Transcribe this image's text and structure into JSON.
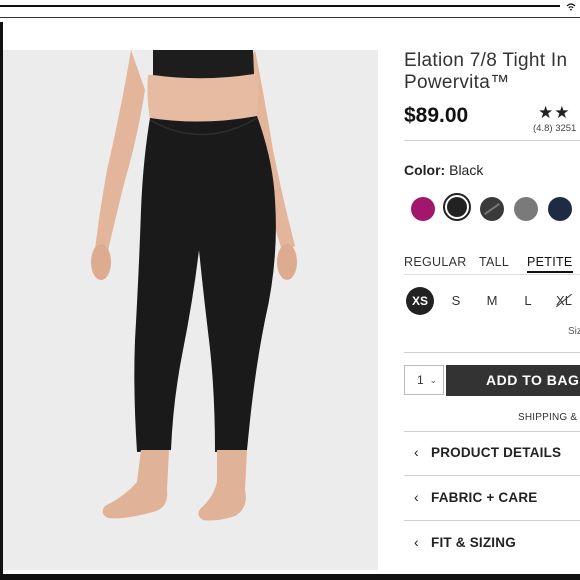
{
  "product": {
    "title": "Elation 7/8 Tight In\nPowervita™",
    "price": "$89.00",
    "stars": "★★",
    "rating": "(4.8)",
    "review_count": "3251"
  },
  "color": {
    "label": "Color:",
    "selected": "Black",
    "swatches": [
      {
        "name": "berry",
        "hex": "#a0176b"
      },
      {
        "name": "black",
        "hex": "#222222",
        "selected": true
      },
      {
        "name": "black-heather",
        "hex": "#3a3a3a"
      },
      {
        "name": "grey-heather",
        "hex": "#7a7a7a"
      },
      {
        "name": "navy",
        "hex": "#1f2b45"
      }
    ]
  },
  "fit": {
    "tabs": [
      "REGULAR",
      "TALL",
      "PETITE"
    ],
    "active": "PETITE"
  },
  "sizes": {
    "options": [
      "XS",
      "S",
      "M",
      "L",
      "XL"
    ],
    "selected": "XS",
    "unavailable": [
      "XL"
    ],
    "size_chart_label": "Siz"
  },
  "purchase": {
    "quantity": "1",
    "add_to_bag": "ADD TO BAG",
    "shipping": "SHIPPING & I"
  },
  "accordions": [
    "PRODUCT DETAILS",
    "FABRIC + CARE",
    "FIT & SIZING"
  ],
  "icons": [
    "wifi-icon",
    "chevron-down-icon",
    "chevron-left-icon"
  ]
}
